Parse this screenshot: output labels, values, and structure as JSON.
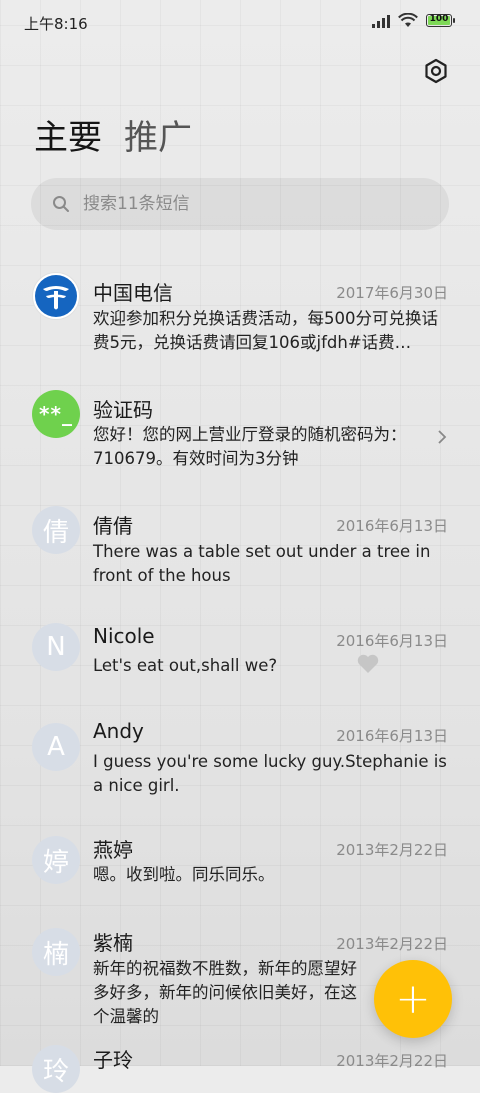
{
  "status_bar": {
    "time": "上午8:16",
    "battery": "100"
  },
  "tabs": [
    {
      "label": "主要"
    },
    {
      "label": "推广"
    }
  ],
  "search": {
    "placeholder": "搜索11条短信"
  },
  "messages": [
    {
      "name": "中国电信",
      "date": "2017年6月30日",
      "preview": "欢迎参加积分兑换话费活动，每500分可兑换话费5元，兑换话费请回复106或jfdh#话费…",
      "avatar": "telecom-logo-icon"
    },
    {
      "name": "验证码",
      "date": "",
      "preview": "您好！您的网上营业厅登录的随机密码为：710679。有效时间为3分钟",
      "avatar_text": "**_"
    },
    {
      "name": "倩倩",
      "date": "2016年6月13日",
      "preview": "There was a table set out under a tree in front of the hous",
      "avatar_text": "倩"
    },
    {
      "name": "Nicole",
      "date": "2016年6月13日",
      "preview": "Let's eat out,shall we?",
      "avatar_text": "N"
    },
    {
      "name": "Andy",
      "date": "2016年6月13日",
      "preview": "I guess you're some lucky guy.Stephanie is a nice girl.",
      "avatar_text": "A"
    },
    {
      "name": "燕婷",
      "date": "2013年2月22日",
      "preview": "嗯。收到啦。同乐同乐。",
      "avatar_text": "婷"
    },
    {
      "name": "紫楠",
      "date": "2013年2月22日",
      "preview": "新年的祝福数不胜数，新年的愿望好多好多，新年的问候依旧美好，在这个温馨的",
      "avatar_text": "楠"
    },
    {
      "name": "子玲",
      "date": "2013年2月22日",
      "preview": "",
      "avatar_text": "玲"
    }
  ],
  "fab": {
    "label": "+"
  },
  "colors": {
    "accent": "#ffc107",
    "verify_avatar": "#6fd14d",
    "telecom_blue": "#1565c0"
  }
}
